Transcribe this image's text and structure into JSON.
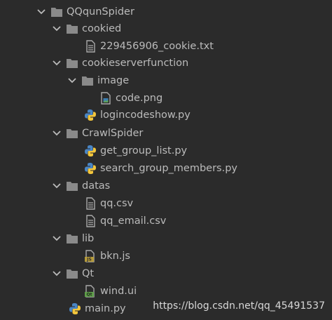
{
  "colors": {
    "background": "#2b2b2b",
    "text": "#bbbbbb",
    "folder": "#8a8a8a",
    "file": "#a9a9a9",
    "python_blue": "#4a86c5",
    "python_yellow": "#f3c63c",
    "js_badge": "#b59a3a",
    "ui_badge": "#5f9e4a"
  },
  "tree": {
    "root": {
      "label": "QQqunSpider",
      "icon": "folder-icon"
    },
    "cookied": {
      "label": "cookied",
      "icon": "folder-icon",
      "files": [
        {
          "label": "229456906_cookie.txt",
          "icon": "text-file-icon"
        }
      ]
    },
    "cookieserverfunction": {
      "label": "cookieserverfunction",
      "icon": "folder-icon",
      "image": {
        "label": "image",
        "icon": "folder-icon",
        "files": [
          {
            "label": "code.png",
            "icon": "image-file-icon"
          }
        ]
      },
      "files": [
        {
          "label": "logincodeshow.py",
          "icon": "python-file-icon"
        }
      ]
    },
    "crawlspider": {
      "label": "CrawlSpider",
      "icon": "folder-icon",
      "files": [
        {
          "label": "get_group_list.py",
          "icon": "python-file-icon"
        },
        {
          "label": "search_group_members.py",
          "icon": "python-file-icon"
        }
      ]
    },
    "datas": {
      "label": "datas",
      "icon": "folder-icon",
      "files": [
        {
          "label": "qq.csv",
          "icon": "text-file-icon"
        },
        {
          "label": "qq_email.csv",
          "icon": "text-file-icon"
        }
      ]
    },
    "lib": {
      "label": "lib",
      "icon": "folder-icon",
      "files": [
        {
          "label": "bkn.js",
          "icon": "js-file-icon",
          "badge": "JS"
        }
      ]
    },
    "qt": {
      "label": "Qt",
      "icon": "folder-icon",
      "files": [
        {
          "label": "wind.ui",
          "icon": "qt-ui-file-icon",
          "badge": "Qt"
        }
      ]
    },
    "main": {
      "label": "main.py",
      "icon": "python-file-icon"
    }
  },
  "watermark": "https://blog.csdn.net/qq_45491537"
}
